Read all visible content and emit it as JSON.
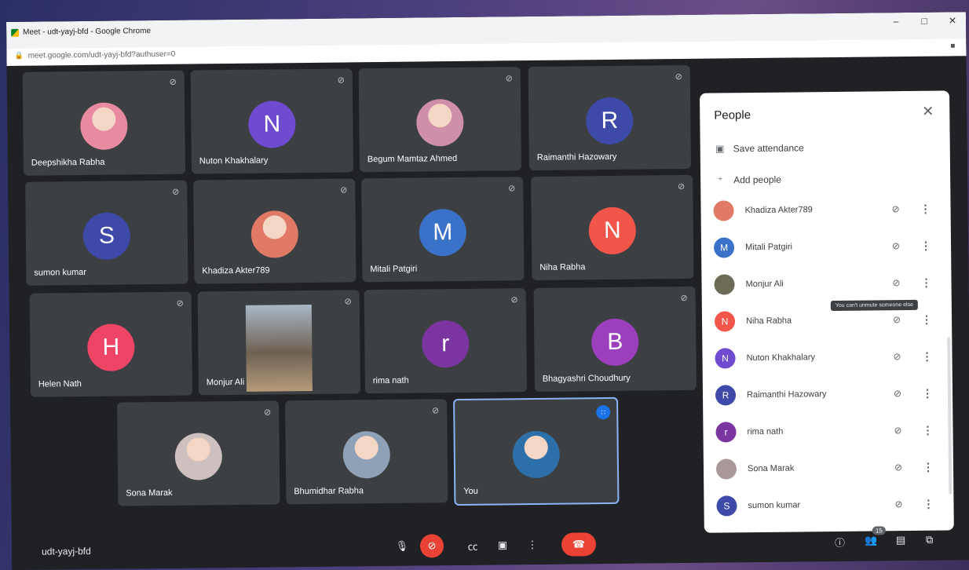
{
  "window": {
    "title": "Meet - udt-yayj-bfd - Google Chrome",
    "url": "meet.google.com/udt-yayj-bfd?authuser=0",
    "controls": [
      "–",
      "□",
      "✕"
    ]
  },
  "tiles": [
    {
      "name": "Deepshikha Rabha",
      "kind": "photo",
      "color": "#e88aa0"
    },
    {
      "name": "Nuton Khakhalary",
      "kind": "letter",
      "initial": "N",
      "color": "#6f4bcf"
    },
    {
      "name": "Begum Mamtaz Ahmed",
      "kind": "photo",
      "color": "#d08fa9"
    },
    {
      "name": "Raimanthi Hazowary",
      "kind": "letter",
      "initial": "R",
      "color": "#3e4aa8"
    },
    {
      "name": "sumon kumar",
      "kind": "letter",
      "initial": "S",
      "color": "#3e4aa8"
    },
    {
      "name": "Khadiza Akter789",
      "kind": "photo",
      "color": "#e07a67"
    },
    {
      "name": "Mitali Patgiri",
      "kind": "letter",
      "initial": "M",
      "color": "#3b72c9"
    },
    {
      "name": "Niha Rabha",
      "kind": "letter",
      "initial": "N",
      "color": "#f2564a"
    },
    {
      "name": "Helen Nath",
      "kind": "letter",
      "initial": "H",
      "color": "#ee4466"
    },
    {
      "name": "Monjur Ali",
      "kind": "video",
      "color": "#8a7a6a"
    },
    {
      "name": "rima nath",
      "kind": "letter",
      "initial": "r",
      "color": "#7b35a0"
    },
    {
      "name": "Bhagyashri Choudhury",
      "kind": "letter",
      "initial": "B",
      "color": "#9c3fbc"
    },
    {
      "name": "Sona Marak",
      "kind": "photo",
      "color": "#cfc0c0"
    },
    {
      "name": "Bhumidhar Rabha",
      "kind": "photo",
      "color": "#8ea1b7"
    },
    {
      "name": "You",
      "kind": "photo",
      "color": "#2d6fa8"
    }
  ],
  "panel": {
    "title": "People",
    "save_attendance": "Save attendance",
    "add_people": "Add people",
    "tooltip": "You can't unmute someone else",
    "people": [
      {
        "name": "Khadiza Akter789",
        "initial": "",
        "color": "#e07a67"
      },
      {
        "name": "Mitali Patgiri",
        "initial": "M",
        "color": "#3b72c9"
      },
      {
        "name": "Monjur Ali",
        "initial": "",
        "color": "#6d6a55"
      },
      {
        "name": "Niha Rabha",
        "initial": "N",
        "color": "#f2564a"
      },
      {
        "name": "Nuton Khakhalary",
        "initial": "N",
        "color": "#6f4bcf"
      },
      {
        "name": "Raimanthi Hazowary",
        "initial": "R",
        "color": "#3e4aa8"
      },
      {
        "name": "rima nath",
        "initial": "r",
        "color": "#7b35a0"
      },
      {
        "name": "Sona Marak",
        "initial": "",
        "color": "#a89898"
      },
      {
        "name": "sumon kumar",
        "initial": "S",
        "color": "#3e4aa8"
      }
    ]
  },
  "bottom": {
    "meeting_code": "udt-yayj-bfd",
    "participant_count": "15"
  },
  "icons": {
    "mic_off": "🎙",
    "more": "⋮",
    "close": "✕"
  }
}
